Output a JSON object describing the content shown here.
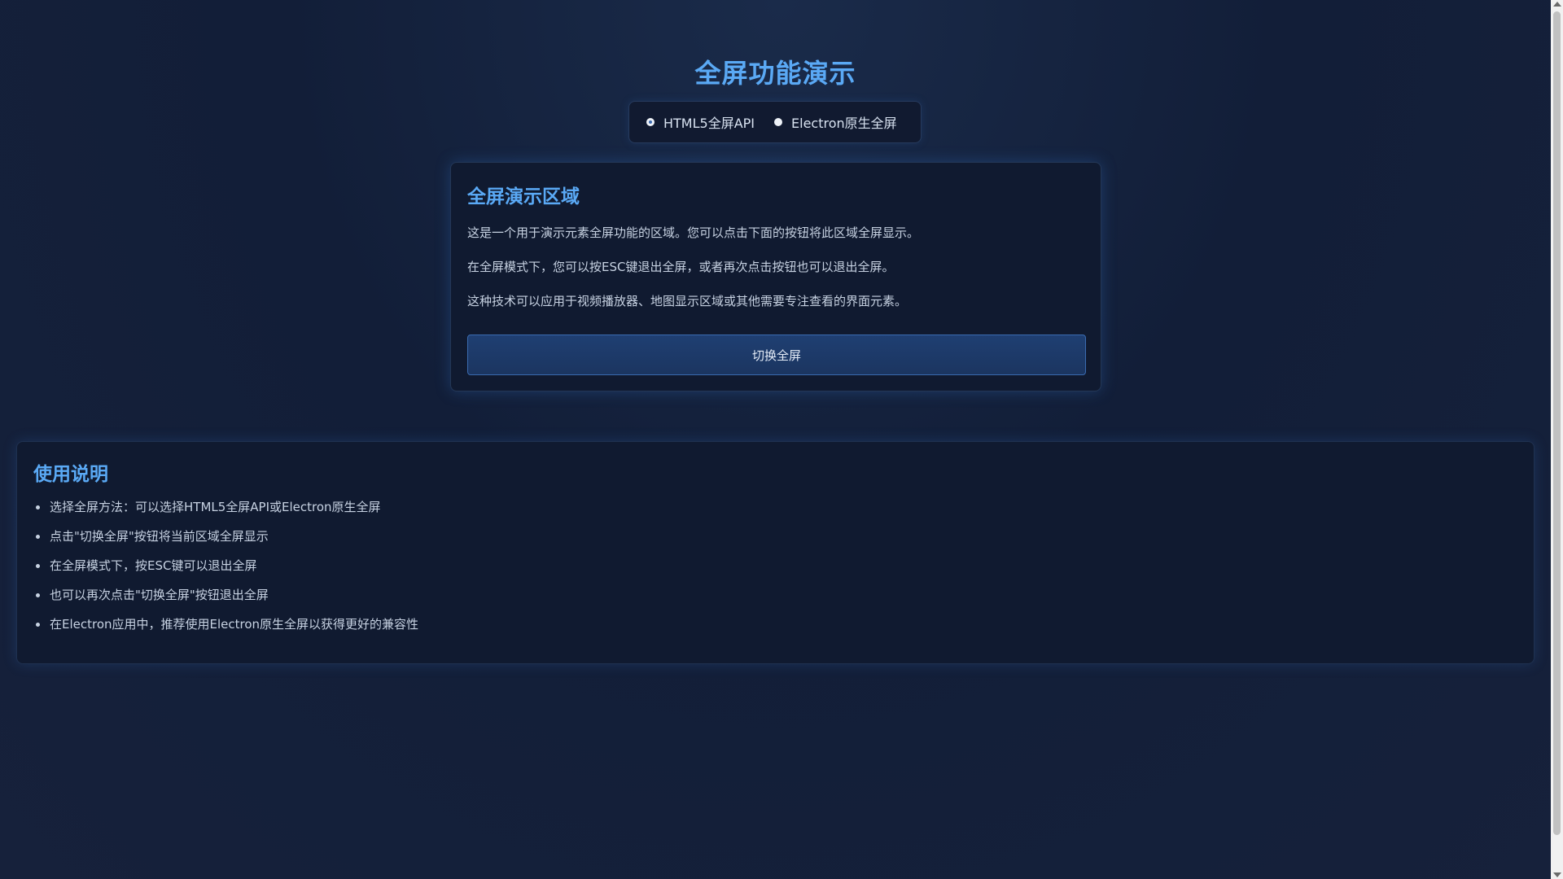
{
  "page": {
    "title": "全屏功能演示"
  },
  "mode_selector": {
    "options": [
      {
        "label": "HTML5全屏API",
        "checked": true
      },
      {
        "label": "Electron原生全屏",
        "checked": false
      }
    ]
  },
  "demo_area": {
    "title": "全屏演示区域",
    "paragraphs": [
      "这是一个用于演示元素全屏功能的区域。您可以点击下面的按钮将此区域全屏显示。",
      "在全屏模式下，您可以按ESC键退出全屏，或者再次点击按钮也可以退出全屏。",
      "这种技术可以应用于视频播放器、地图显示区域或其他需要专注查看的界面元素。"
    ],
    "toggle_button_label": "切换全屏"
  },
  "instructions": {
    "title": "使用说明",
    "items": [
      "选择全屏方法：可以选择HTML5全屏API或Electron原生全屏",
      "点击\"切换全屏\"按钮将当前区域全屏显示",
      "在全屏模式下，按ESC键可以退出全屏",
      "也可以再次点击\"切换全屏\"按钮退出全屏",
      "在Electron应用中，推荐使用Electron原生全屏以获得更好的兼容性"
    ]
  },
  "colors": {
    "accent": "#5aa9f5",
    "background": "#121e38",
    "panel": "#101a30",
    "button": "#1f3f72"
  }
}
